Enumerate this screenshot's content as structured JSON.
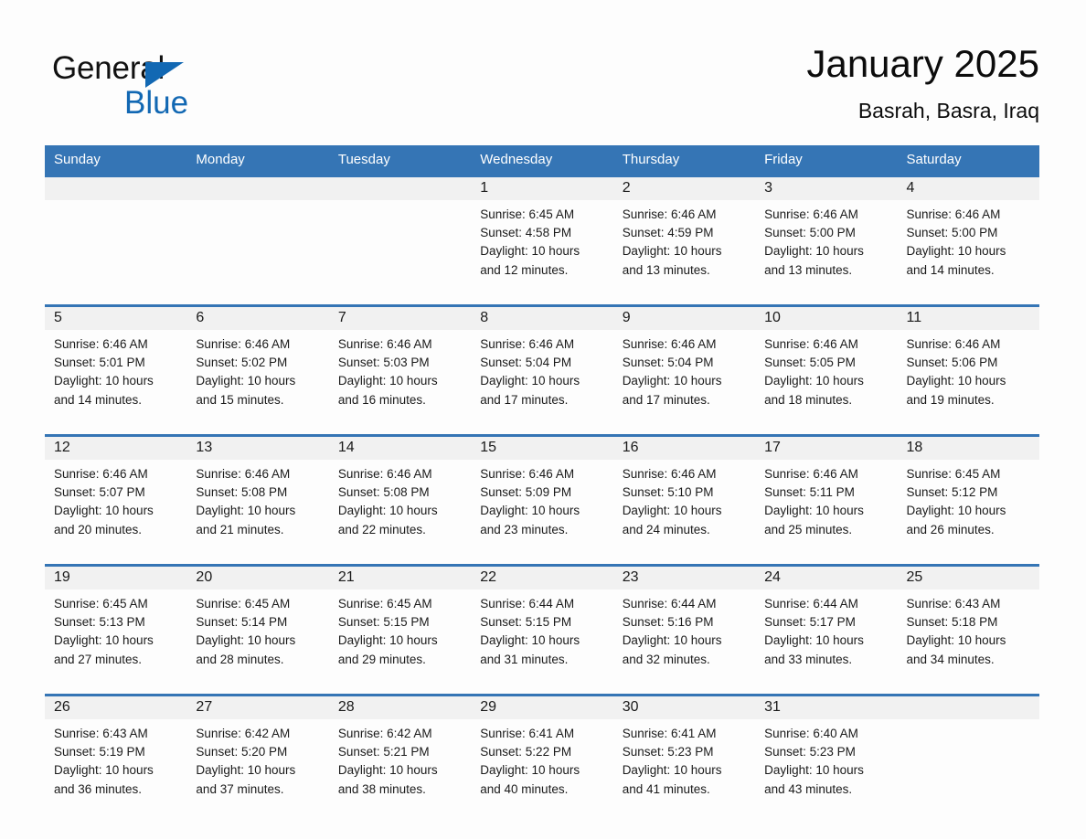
{
  "brand": {
    "name_part1": "General",
    "name_part2": "Blue",
    "triangle_color": "#1268b3",
    "text_color_primary": "#111111",
    "text_color_accent": "#1268b3"
  },
  "header": {
    "title": "January 2025",
    "subtitle": "Basrah, Basra, Iraq"
  },
  "colors": {
    "header_blue": "#3575b5",
    "day_band_gray": "#f1f1f1",
    "page_background": "#fdfdfd",
    "text": "#1a1a1a"
  },
  "weekday_headers": [
    "Sunday",
    "Monday",
    "Tuesday",
    "Wednesday",
    "Thursday",
    "Friday",
    "Saturday"
  ],
  "weeks": [
    [
      {
        "day": "",
        "sunrise": "",
        "sunset": "",
        "daylight_line1": "",
        "daylight_line2": "",
        "empty": true
      },
      {
        "day": "",
        "sunrise": "",
        "sunset": "",
        "daylight_line1": "",
        "daylight_line2": "",
        "empty": true
      },
      {
        "day": "",
        "sunrise": "",
        "sunset": "",
        "daylight_line1": "",
        "daylight_line2": "",
        "empty": true
      },
      {
        "day": "1",
        "sunrise": "Sunrise: 6:45 AM",
        "sunset": "Sunset: 4:58 PM",
        "daylight_line1": "Daylight: 10 hours",
        "daylight_line2": "and 12 minutes."
      },
      {
        "day": "2",
        "sunrise": "Sunrise: 6:46 AM",
        "sunset": "Sunset: 4:59 PM",
        "daylight_line1": "Daylight: 10 hours",
        "daylight_line2": "and 13 minutes."
      },
      {
        "day": "3",
        "sunrise": "Sunrise: 6:46 AM",
        "sunset": "Sunset: 5:00 PM",
        "daylight_line1": "Daylight: 10 hours",
        "daylight_line2": "and 13 minutes."
      },
      {
        "day": "4",
        "sunrise": "Sunrise: 6:46 AM",
        "sunset": "Sunset: 5:00 PM",
        "daylight_line1": "Daylight: 10 hours",
        "daylight_line2": "and 14 minutes."
      }
    ],
    [
      {
        "day": "5",
        "sunrise": "Sunrise: 6:46 AM",
        "sunset": "Sunset: 5:01 PM",
        "daylight_line1": "Daylight: 10 hours",
        "daylight_line2": "and 14 minutes."
      },
      {
        "day": "6",
        "sunrise": "Sunrise: 6:46 AM",
        "sunset": "Sunset: 5:02 PM",
        "daylight_line1": "Daylight: 10 hours",
        "daylight_line2": "and 15 minutes."
      },
      {
        "day": "7",
        "sunrise": "Sunrise: 6:46 AM",
        "sunset": "Sunset: 5:03 PM",
        "daylight_line1": "Daylight: 10 hours",
        "daylight_line2": "and 16 minutes."
      },
      {
        "day": "8",
        "sunrise": "Sunrise: 6:46 AM",
        "sunset": "Sunset: 5:04 PM",
        "daylight_line1": "Daylight: 10 hours",
        "daylight_line2": "and 17 minutes."
      },
      {
        "day": "9",
        "sunrise": "Sunrise: 6:46 AM",
        "sunset": "Sunset: 5:04 PM",
        "daylight_line1": "Daylight: 10 hours",
        "daylight_line2": "and 17 minutes."
      },
      {
        "day": "10",
        "sunrise": "Sunrise: 6:46 AM",
        "sunset": "Sunset: 5:05 PM",
        "daylight_line1": "Daylight: 10 hours",
        "daylight_line2": "and 18 minutes."
      },
      {
        "day": "11",
        "sunrise": "Sunrise: 6:46 AM",
        "sunset": "Sunset: 5:06 PM",
        "daylight_line1": "Daylight: 10 hours",
        "daylight_line2": "and 19 minutes."
      }
    ],
    [
      {
        "day": "12",
        "sunrise": "Sunrise: 6:46 AM",
        "sunset": "Sunset: 5:07 PM",
        "daylight_line1": "Daylight: 10 hours",
        "daylight_line2": "and 20 minutes."
      },
      {
        "day": "13",
        "sunrise": "Sunrise: 6:46 AM",
        "sunset": "Sunset: 5:08 PM",
        "daylight_line1": "Daylight: 10 hours",
        "daylight_line2": "and 21 minutes."
      },
      {
        "day": "14",
        "sunrise": "Sunrise: 6:46 AM",
        "sunset": "Sunset: 5:08 PM",
        "daylight_line1": "Daylight: 10 hours",
        "daylight_line2": "and 22 minutes."
      },
      {
        "day": "15",
        "sunrise": "Sunrise: 6:46 AM",
        "sunset": "Sunset: 5:09 PM",
        "daylight_line1": "Daylight: 10 hours",
        "daylight_line2": "and 23 minutes."
      },
      {
        "day": "16",
        "sunrise": "Sunrise: 6:46 AM",
        "sunset": "Sunset: 5:10 PM",
        "daylight_line1": "Daylight: 10 hours",
        "daylight_line2": "and 24 minutes."
      },
      {
        "day": "17",
        "sunrise": "Sunrise: 6:46 AM",
        "sunset": "Sunset: 5:11 PM",
        "daylight_line1": "Daylight: 10 hours",
        "daylight_line2": "and 25 minutes."
      },
      {
        "day": "18",
        "sunrise": "Sunrise: 6:45 AM",
        "sunset": "Sunset: 5:12 PM",
        "daylight_line1": "Daylight: 10 hours",
        "daylight_line2": "and 26 minutes."
      }
    ],
    [
      {
        "day": "19",
        "sunrise": "Sunrise: 6:45 AM",
        "sunset": "Sunset: 5:13 PM",
        "daylight_line1": "Daylight: 10 hours",
        "daylight_line2": "and 27 minutes."
      },
      {
        "day": "20",
        "sunrise": "Sunrise: 6:45 AM",
        "sunset": "Sunset: 5:14 PM",
        "daylight_line1": "Daylight: 10 hours",
        "daylight_line2": "and 28 minutes."
      },
      {
        "day": "21",
        "sunrise": "Sunrise: 6:45 AM",
        "sunset": "Sunset: 5:15 PM",
        "daylight_line1": "Daylight: 10 hours",
        "daylight_line2": "and 29 minutes."
      },
      {
        "day": "22",
        "sunrise": "Sunrise: 6:44 AM",
        "sunset": "Sunset: 5:15 PM",
        "daylight_line1": "Daylight: 10 hours",
        "daylight_line2": "and 31 minutes."
      },
      {
        "day": "23",
        "sunrise": "Sunrise: 6:44 AM",
        "sunset": "Sunset: 5:16 PM",
        "daylight_line1": "Daylight: 10 hours",
        "daylight_line2": "and 32 minutes."
      },
      {
        "day": "24",
        "sunrise": "Sunrise: 6:44 AM",
        "sunset": "Sunset: 5:17 PM",
        "daylight_line1": "Daylight: 10 hours",
        "daylight_line2": "and 33 minutes."
      },
      {
        "day": "25",
        "sunrise": "Sunrise: 6:43 AM",
        "sunset": "Sunset: 5:18 PM",
        "daylight_line1": "Daylight: 10 hours",
        "daylight_line2": "and 34 minutes."
      }
    ],
    [
      {
        "day": "26",
        "sunrise": "Sunrise: 6:43 AM",
        "sunset": "Sunset: 5:19 PM",
        "daylight_line1": "Daylight: 10 hours",
        "daylight_line2": "and 36 minutes."
      },
      {
        "day": "27",
        "sunrise": "Sunrise: 6:42 AM",
        "sunset": "Sunset: 5:20 PM",
        "daylight_line1": "Daylight: 10 hours",
        "daylight_line2": "and 37 minutes."
      },
      {
        "day": "28",
        "sunrise": "Sunrise: 6:42 AM",
        "sunset": "Sunset: 5:21 PM",
        "daylight_line1": "Daylight: 10 hours",
        "daylight_line2": "and 38 minutes."
      },
      {
        "day": "29",
        "sunrise": "Sunrise: 6:41 AM",
        "sunset": "Sunset: 5:22 PM",
        "daylight_line1": "Daylight: 10 hours",
        "daylight_line2": "and 40 minutes."
      },
      {
        "day": "30",
        "sunrise": "Sunrise: 6:41 AM",
        "sunset": "Sunset: 5:23 PM",
        "daylight_line1": "Daylight: 10 hours",
        "daylight_line2": "and 41 minutes."
      },
      {
        "day": "31",
        "sunrise": "Sunrise: 6:40 AM",
        "sunset": "Sunset: 5:23 PM",
        "daylight_line1": "Daylight: 10 hours",
        "daylight_line2": "and 43 minutes."
      },
      {
        "day": "",
        "sunrise": "",
        "sunset": "",
        "daylight_line1": "",
        "daylight_line2": "",
        "empty": true
      }
    ]
  ]
}
